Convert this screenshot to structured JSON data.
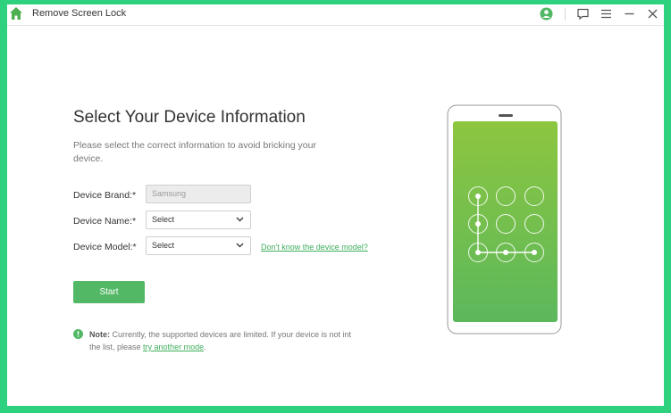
{
  "window": {
    "title": "Remove Screen Lock"
  },
  "titlebar_icons": [
    "home-icon",
    "user-account-icon",
    "feedback-icon",
    "menu-icon",
    "minimize-icon",
    "close-icon"
  ],
  "main": {
    "heading": "Select Your Device Information",
    "subtitle": "Please select the correct information to avoid bricking your device."
  },
  "form": {
    "brand_label": "Device Brand:*",
    "brand_value": "Samsung",
    "name_label": "Device Name:*",
    "name_value": "Select",
    "model_label": "Device Model:*",
    "model_value": "Select",
    "model_help_link": "Don't know the device model?"
  },
  "start_button": "Start",
  "note": {
    "prefix": "Note:",
    "text": " Currently, the supported devices are limited. If your device is not int the list, please ",
    "link": "try another mode",
    "suffix": "."
  },
  "colors": {
    "accent": "#52b865",
    "frame": "#2ed27e",
    "screen_top": "#8dc63f",
    "screen_bottom": "#5cb85c"
  }
}
